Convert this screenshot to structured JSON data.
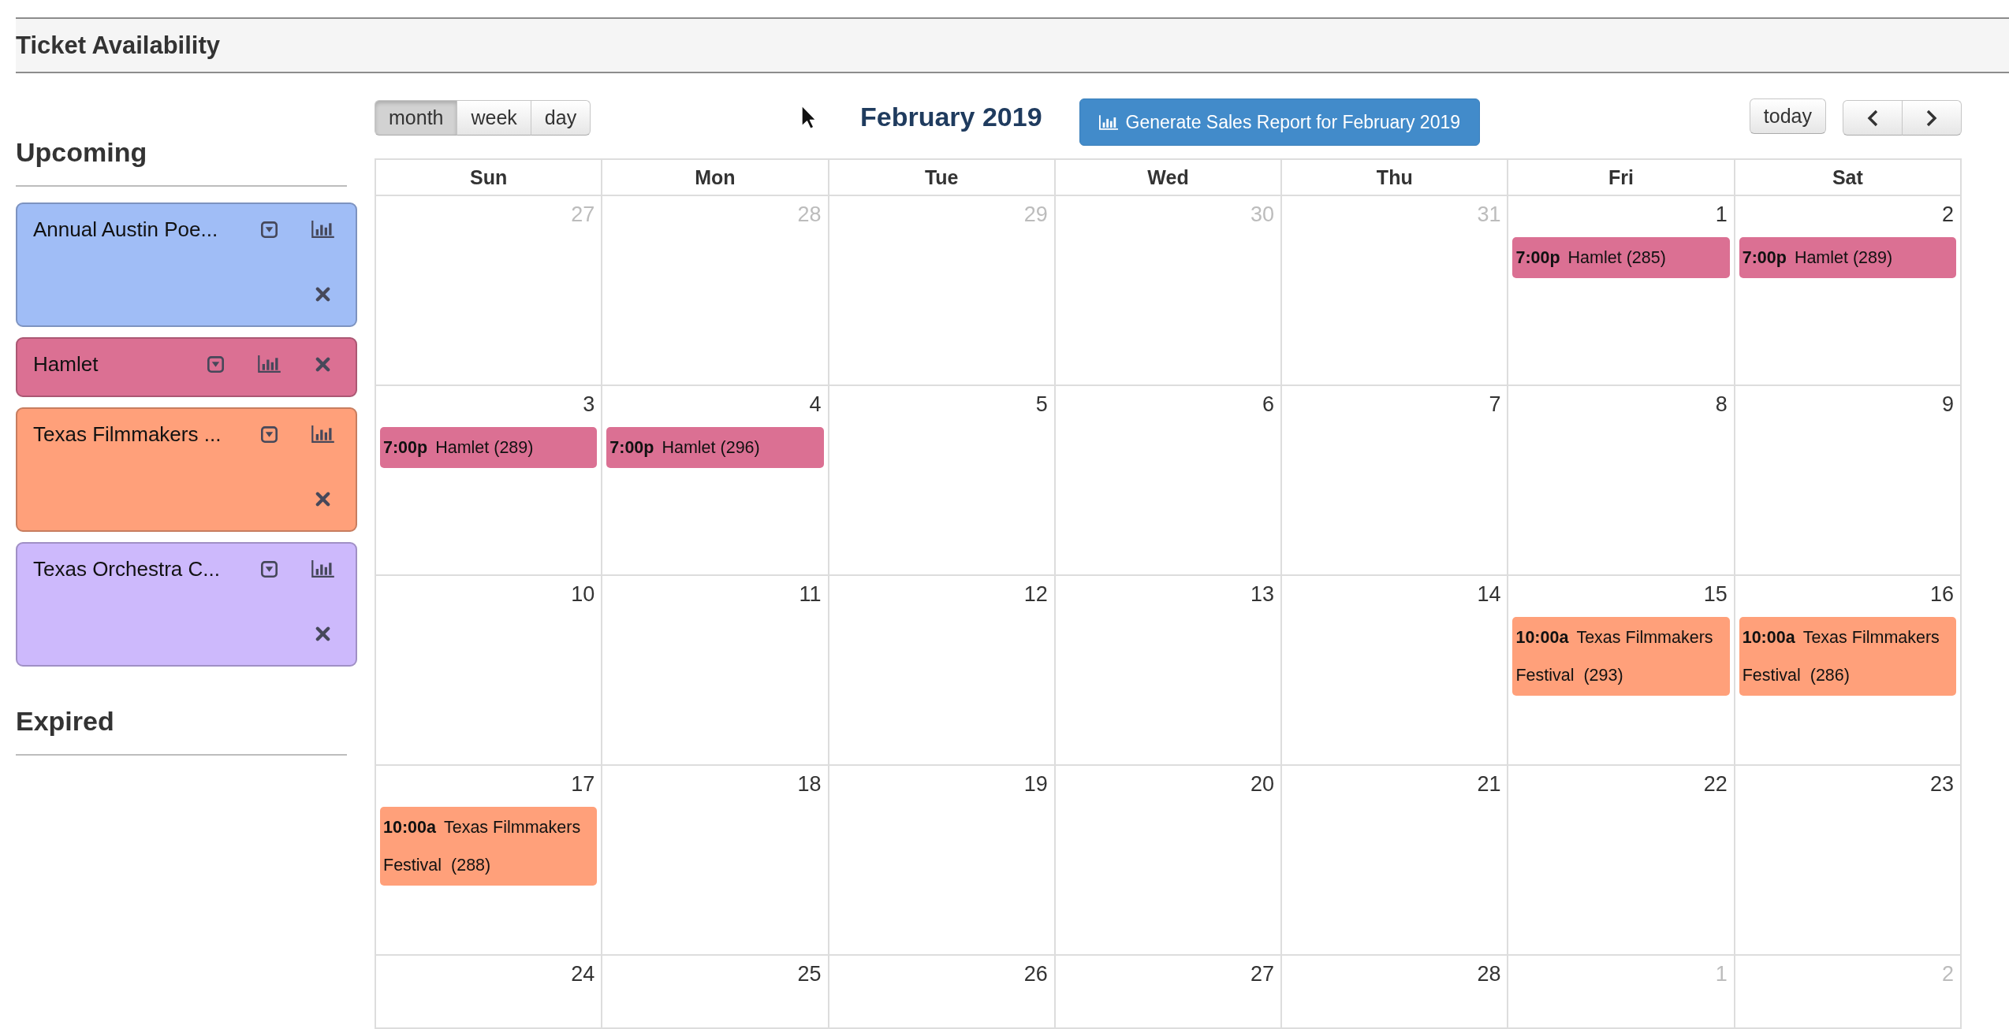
{
  "header": {
    "title": "Ticket Availability"
  },
  "sidebar": {
    "sections": [
      {
        "heading": "Upcoming",
        "events": [
          {
            "name": "Annual Austin Poe...",
            "color": "#a0bdf6"
          },
          {
            "name": "Hamlet",
            "color": "#db7093"
          },
          {
            "name": "Texas Filmmakers ...",
            "color": "#ffa07a"
          },
          {
            "name": "Texas Orchestra C...",
            "color": "#cdb9fc"
          }
        ]
      },
      {
        "heading": "Expired"
      }
    ]
  },
  "calendar": {
    "views": [
      {
        "label": "month",
        "selected": true
      },
      {
        "label": "week",
        "selected": false
      },
      {
        "label": "day",
        "selected": false
      }
    ],
    "title": "February 2019",
    "report_button": "Generate Sales Report for February 2019",
    "today_button": "today",
    "weekdays": [
      "Sun",
      "Mon",
      "Tue",
      "Wed",
      "Thu",
      "Fri",
      "Sat"
    ],
    "weeks": [
      {
        "days": [
          {
            "day": "27",
            "other_month": true
          },
          {
            "day": "28",
            "other_month": true
          },
          {
            "day": "29",
            "other_month": true
          },
          {
            "day": "30",
            "other_month": true
          },
          {
            "day": "31",
            "other_month": true
          },
          {
            "day": "1",
            "other_month": false,
            "events": [
              {
                "time": "7:00p",
                "title": "Hamlet (285)",
                "color": "#db7093"
              }
            ]
          },
          {
            "day": "2",
            "other_month": false,
            "events": [
              {
                "time": "7:00p",
                "title": "Hamlet (289)",
                "color": "#db7093"
              }
            ]
          }
        ]
      },
      {
        "days": [
          {
            "day": "3",
            "other_month": false,
            "events": [
              {
                "time": "7:00p",
                "title": "Hamlet (289)",
                "color": "#db7093"
              }
            ]
          },
          {
            "day": "4",
            "other_month": false,
            "events": [
              {
                "time": "7:00p",
                "title": "Hamlet (296)",
                "color": "#db7093"
              }
            ]
          },
          {
            "day": "5",
            "other_month": false
          },
          {
            "day": "6",
            "other_month": false
          },
          {
            "day": "7",
            "other_month": false
          },
          {
            "day": "8",
            "other_month": false
          },
          {
            "day": "9",
            "other_month": false
          }
        ]
      },
      {
        "days": [
          {
            "day": "10",
            "other_month": false
          },
          {
            "day": "11",
            "other_month": false
          },
          {
            "day": "12",
            "other_month": false
          },
          {
            "day": "13",
            "other_month": false
          },
          {
            "day": "14",
            "other_month": false
          },
          {
            "day": "15",
            "other_month": false,
            "events": [
              {
                "time": "10:00a",
                "title": "Texas Filmmakers Festival  (293)",
                "color": "#ffa07a"
              }
            ]
          },
          {
            "day": "16",
            "other_month": false,
            "events": [
              {
                "time": "10:00a",
                "title": "Texas Filmmakers Festival  (286)",
                "color": "#ffa07a"
              }
            ]
          }
        ]
      },
      {
        "days": [
          {
            "day": "17",
            "other_month": false,
            "events": [
              {
                "time": "10:00a",
                "title": "Texas Filmmakers Festival  (288)",
                "color": "#ffa07a"
              }
            ]
          },
          {
            "day": "18",
            "other_month": false
          },
          {
            "day": "19",
            "other_month": false
          },
          {
            "day": "20",
            "other_month": false
          },
          {
            "day": "21",
            "other_month": false
          },
          {
            "day": "22",
            "other_month": false
          },
          {
            "day": "23",
            "other_month": false
          }
        ]
      },
      {
        "days": [
          {
            "day": "24",
            "other_month": false
          },
          {
            "day": "25",
            "other_month": false
          },
          {
            "day": "26",
            "other_month": false
          },
          {
            "day": "27",
            "other_month": false
          },
          {
            "day": "28",
            "other_month": false
          },
          {
            "day": "1",
            "other_month": true
          },
          {
            "day": "2",
            "other_month": true
          }
        ]
      }
    ]
  }
}
